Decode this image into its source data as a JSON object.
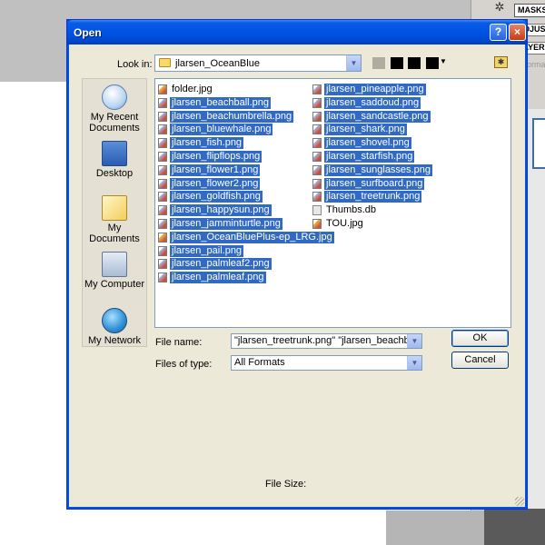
{
  "background_app": {
    "tabs": [
      "MASKS",
      "ADJUS",
      "LAYER"
    ],
    "hint_text": "ormal"
  },
  "dialog": {
    "title": "Open",
    "help_label": "?",
    "close_label": "×",
    "look_in": {
      "label": "Look in:",
      "value": "jlarsen_OceanBlue"
    },
    "places": [
      {
        "label": "My Recent Documents",
        "icon": "recent-documents-icon"
      },
      {
        "label": "Desktop",
        "icon": "desktop-icon"
      },
      {
        "label": "My Documents",
        "icon": "my-documents-icon"
      },
      {
        "label": "My Computer",
        "icon": "my-computer-icon"
      },
      {
        "label": "My Network",
        "icon": "my-network-icon"
      }
    ],
    "files_col1": [
      {
        "name": "folder.jpg",
        "selected": false
      },
      {
        "name": "jlarsen_beachball.png",
        "selected": true
      },
      {
        "name": "jlarsen_beachumbrella.png",
        "selected": true
      },
      {
        "name": "jlarsen_bluewhale.png",
        "selected": true
      },
      {
        "name": "jlarsen_fish.png",
        "selected": true
      },
      {
        "name": "jlarsen_flipflops.png",
        "selected": true
      },
      {
        "name": "jlarsen_flower1.png",
        "selected": true
      },
      {
        "name": "jlarsen_flower2.png",
        "selected": true
      },
      {
        "name": "jlarsen_goldfish.png",
        "selected": true
      },
      {
        "name": "jlarsen_happysun.png",
        "selected": true
      },
      {
        "name": "jlarsen_jamminturtle.png",
        "selected": true
      },
      {
        "name": "jlarsen_OceanBluePlus-ep_LRG.jpg",
        "selected": true
      },
      {
        "name": "jlarsen_pail.png",
        "selected": true
      },
      {
        "name": "jlarsen_palmleaf2.png",
        "selected": true
      },
      {
        "name": "jlarsen_palmleaf.png",
        "selected": true
      }
    ],
    "files_col2": [
      {
        "name": "jlarsen_pineapple.png",
        "selected": true
      },
      {
        "name": "jlarsen_saddoud.png",
        "selected": true
      },
      {
        "name": "jlarsen_sandcastle.png",
        "selected": true
      },
      {
        "name": "jlarsen_shark.png",
        "selected": true
      },
      {
        "name": "jlarsen_shovel.png",
        "selected": true
      },
      {
        "name": "jlarsen_starfish.png",
        "selected": true
      },
      {
        "name": "jlarsen_sunglasses.png",
        "selected": true
      },
      {
        "name": "jlarsen_surfboard.png",
        "selected": true
      },
      {
        "name": "jlarsen_treetrunk.png",
        "selected": true
      },
      {
        "name": "Thumbs.db",
        "selected": false
      },
      {
        "name": "TOU.jpg",
        "selected": false
      }
    ],
    "file_name": {
      "label": "File name:",
      "value": "\"jlarsen_treetrunk.png\" \"jlarsen_beachball.png"
    },
    "files_of_type": {
      "label": "Files of type:",
      "value": "All Formats"
    },
    "ok_label": "OK",
    "cancel_label": "Cancel",
    "file_size_label": "File Size:"
  },
  "colors": {
    "titlebar": "#0054e3",
    "selection": "#316ac5",
    "dialog_bg": "#ece9d8"
  }
}
